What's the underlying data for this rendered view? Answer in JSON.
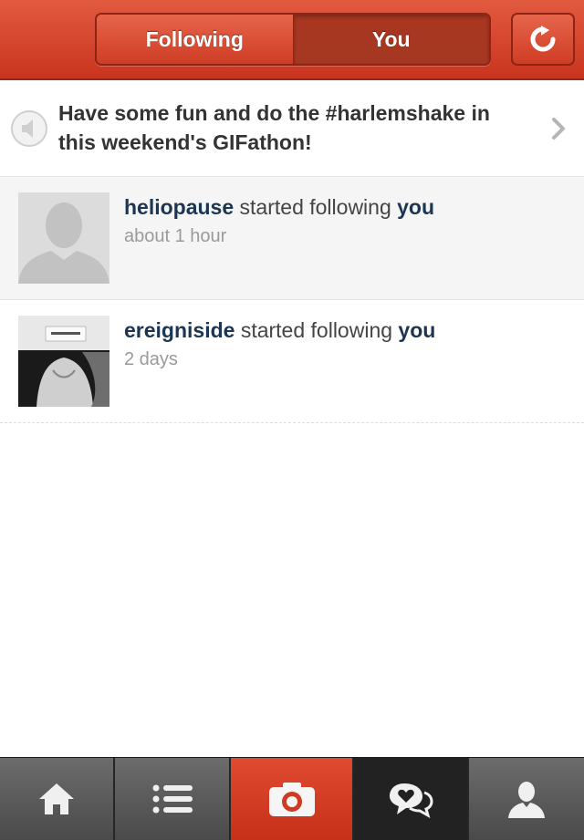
{
  "header": {
    "tabs": [
      {
        "label": "Following",
        "active": false
      },
      {
        "label": "You",
        "active": true
      }
    ],
    "refresh_icon": "refresh-icon",
    "colors": {
      "bar": "#d4432a",
      "active_segment": "#a63823"
    }
  },
  "announcement": {
    "icon": "speaker-icon",
    "text": "Have some fun and do the #harlemshake in this weekend's GIFathon!",
    "chevron_icon": "chevron-right-icon"
  },
  "activity": [
    {
      "username": "heliopause",
      "action": "started following",
      "target": "you",
      "time": "about 1 hour",
      "avatar": "default-avatar"
    },
    {
      "username": "ereigniside",
      "action": "started following",
      "target": "you",
      "time": "2 days",
      "avatar": "photo-avatar"
    }
  ],
  "tabbar": {
    "items": [
      {
        "icon": "home-icon"
      },
      {
        "icon": "list-icon"
      },
      {
        "icon": "camera-icon"
      },
      {
        "icon": "chat-heart-icon",
        "selected": true
      },
      {
        "icon": "profile-icon"
      }
    ],
    "colors": {
      "camera": "#d43b22",
      "selected": "#222222"
    }
  }
}
